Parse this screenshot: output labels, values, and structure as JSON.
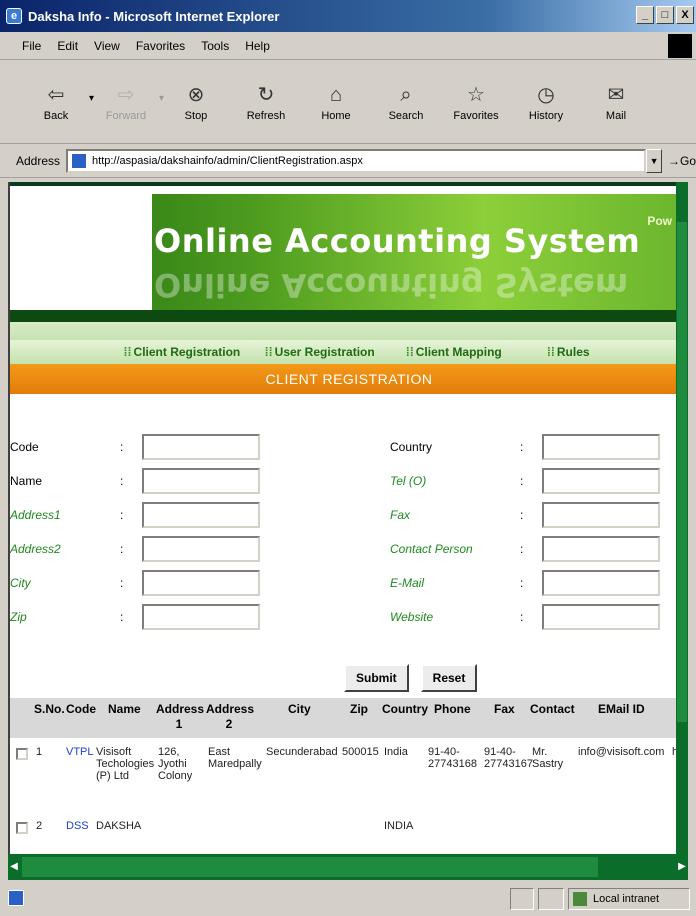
{
  "window": {
    "title": "Daksha Info - Microsoft Internet Explorer",
    "controls": [
      "_",
      "□",
      "X"
    ]
  },
  "menu": [
    "File",
    "Edit",
    "View",
    "Favorites",
    "Tools",
    "Help"
  ],
  "toolbar": [
    {
      "label": "Back",
      "icon": "back-arrow-icon",
      "glyph": "⇦",
      "enabled": true
    },
    {
      "label": "Forward",
      "icon": "forward-arrow-icon",
      "glyph": "⇨",
      "enabled": false
    },
    {
      "label": "Stop",
      "icon": "stop-icon",
      "glyph": "⊗",
      "enabled": true
    },
    {
      "label": "Refresh",
      "icon": "refresh-icon",
      "glyph": "↻",
      "enabled": true
    },
    {
      "label": "Home",
      "icon": "home-icon",
      "glyph": "⌂",
      "enabled": true
    },
    {
      "label": "Search",
      "icon": "search-icon",
      "glyph": "⌕",
      "enabled": true
    },
    {
      "label": "Favorites",
      "icon": "favorites-icon",
      "glyph": "☆",
      "enabled": true
    },
    {
      "label": "History",
      "icon": "history-icon",
      "glyph": "◷",
      "enabled": true
    },
    {
      "label": "Mail",
      "icon": "mail-icon",
      "glyph": "✉",
      "enabled": true
    }
  ],
  "address": {
    "label": "Address",
    "url": "http://aspasia/dakshainfo/admin/ClientRegistration.aspx",
    "go": "Go"
  },
  "banner": {
    "title": "Online Accounting System",
    "powered": "Pow"
  },
  "nav": [
    "Client Registration",
    "User Registration",
    "Client Mapping",
    "Rules"
  ],
  "section_title": "CLIENT REGISTRATION",
  "form": {
    "left": [
      {
        "label": "Code",
        "required": true
      },
      {
        "label": "Name",
        "required": true
      },
      {
        "label": "Address1",
        "required": false
      },
      {
        "label": "Address2",
        "required": false
      },
      {
        "label": "City",
        "required": false
      },
      {
        "label": "Zip",
        "required": false
      }
    ],
    "right": [
      {
        "label": "Country",
        "required": true
      },
      {
        "label": "Tel (O)",
        "required": false
      },
      {
        "label": "Fax",
        "required": false
      },
      {
        "label": "Contact Person",
        "required": false
      },
      {
        "label": "E-Mail",
        "required": false
      },
      {
        "label": "Website",
        "required": false
      }
    ],
    "colon": ":",
    "submit": "Submit",
    "reset": "Reset"
  },
  "grid": {
    "headers": [
      "S.No.",
      "Code",
      "Name",
      "Address 1",
      "Address 2",
      "City",
      "Zip",
      "Country",
      "Phone",
      "Fax",
      "Contact",
      "EMail ID"
    ],
    "rows": [
      {
        "sno": "1",
        "code": "VTPL",
        "name": "Visisoft Techologies (P) Ltd",
        "address1": "126, Jyothi Colony",
        "address2": "East Maredpally",
        "city": "Secunderabad",
        "zip": "500015",
        "country": "India",
        "phone": "91-40-27743168",
        "fax": "91-40-27743167",
        "contact": "Mr. Sastry",
        "email": "info@visisoft.com",
        "website": "http"
      },
      {
        "sno": "2",
        "code": "DSS",
        "name": "DAKSHA",
        "country": "INDIA"
      }
    ]
  },
  "status": {
    "zone": "Local intranet"
  },
  "colors": {
    "accent_orange": "#e88a10",
    "banner_green": "#4c9a1e",
    "label_green": "#1d8a1d",
    "link_blue": "#1a3fd6"
  }
}
